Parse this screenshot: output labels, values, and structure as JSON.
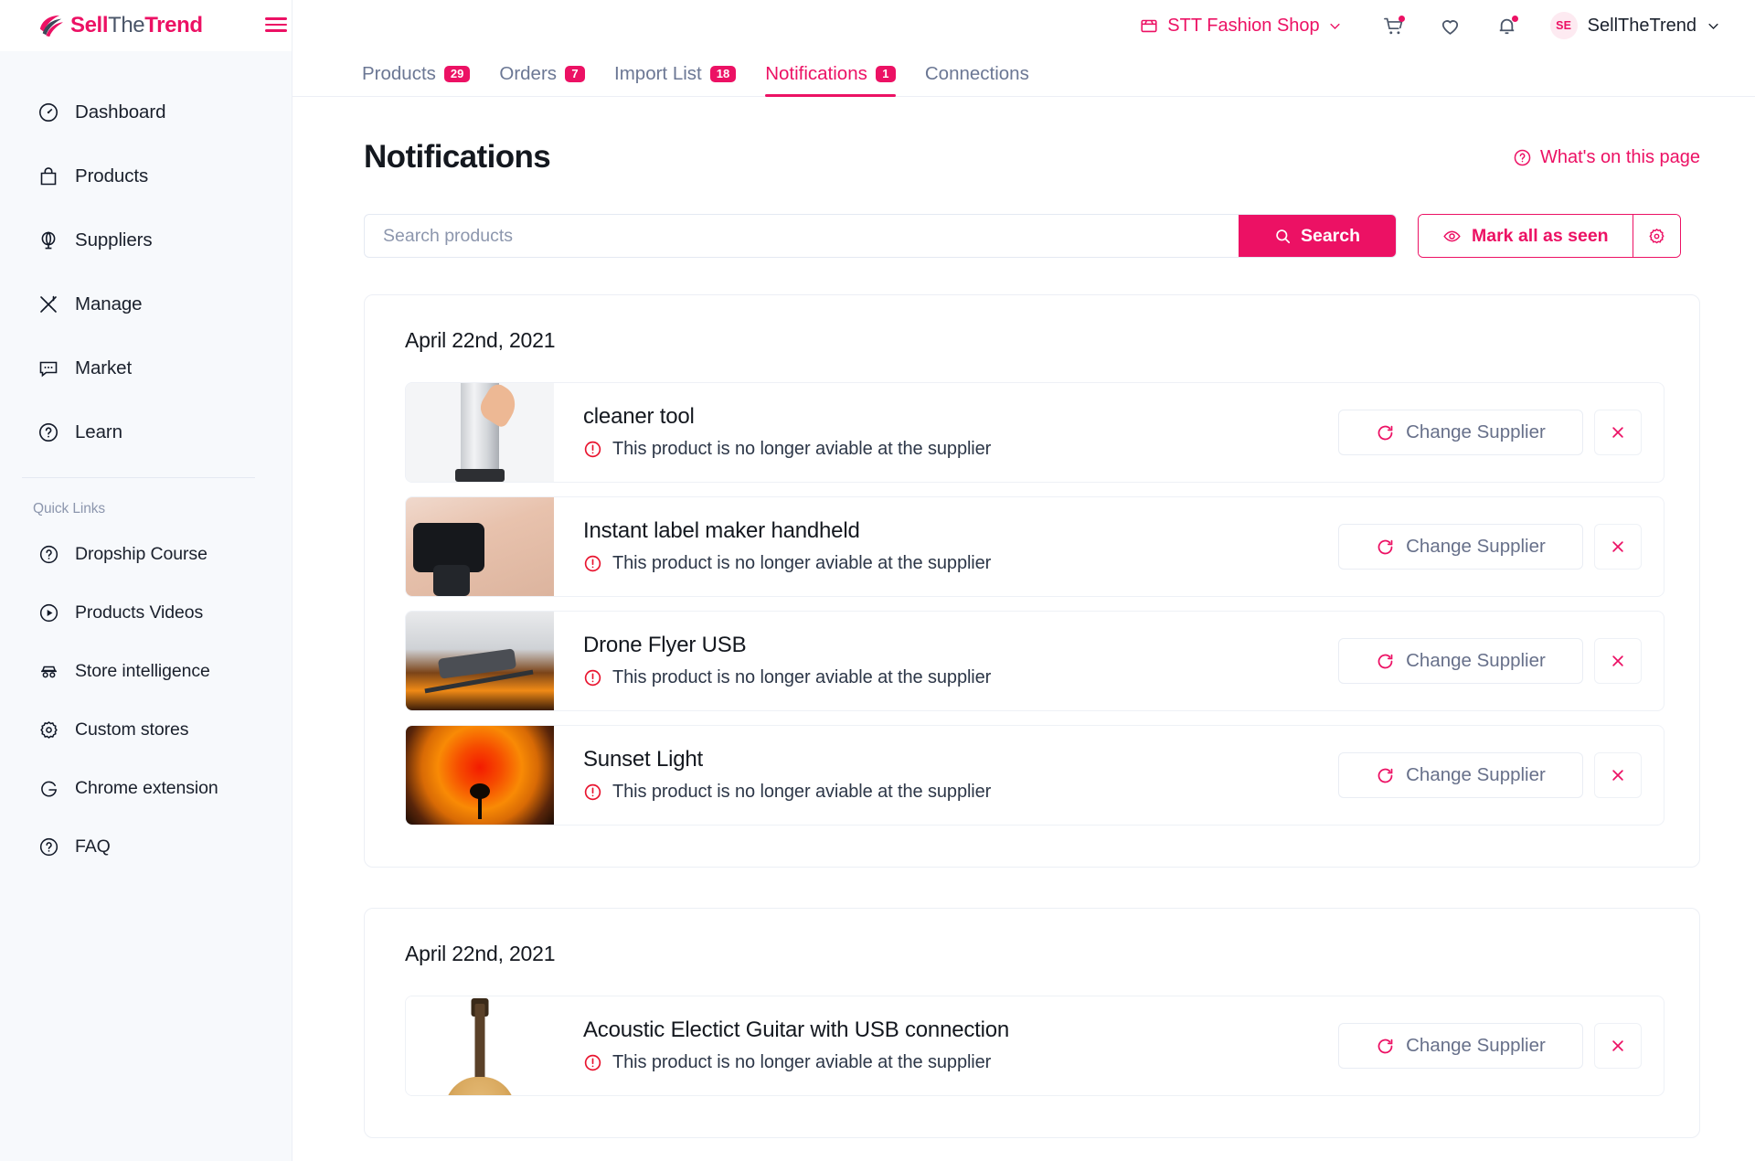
{
  "brand": {
    "logo_sell": "Sell",
    "logo_the": "The",
    "logo_trend": "Trend",
    "accent_color": "#ec1164",
    "menu_icon": "hamburger-icon"
  },
  "sidebar": {
    "items": [
      {
        "label": "Dashboard",
        "icon": "speedometer-icon"
      },
      {
        "label": "Products",
        "icon": "bag-icon"
      },
      {
        "label": "Suppliers",
        "icon": "globe-icon"
      },
      {
        "label": "Manage",
        "icon": "tools-icon"
      },
      {
        "label": "Market",
        "icon": "chat-icon"
      },
      {
        "label": "Learn",
        "icon": "question-circle-icon"
      }
    ],
    "quick_links_title": "Quick Links",
    "quick_links": [
      {
        "label": "Dropship Course",
        "icon": "question-circle-icon"
      },
      {
        "label": "Products Videos",
        "icon": "play-circle-icon"
      },
      {
        "label": "Store intelligence",
        "icon": "spy-icon"
      },
      {
        "label": "Custom stores",
        "icon": "gear-icon"
      },
      {
        "label": "Chrome extension",
        "icon": "google-g-icon"
      },
      {
        "label": "FAQ",
        "icon": "question-circle-icon"
      }
    ]
  },
  "topbar": {
    "shop_name": "STT Fashion Shop",
    "shop_icon": "store-icon",
    "shop_chevron": "chevron-down-icon",
    "cart_icon": "cart-icon",
    "wishlist_icon": "heart-icon",
    "bell_icon": "bell-icon",
    "avatar_initials": "SE",
    "user_name": "SellTheTrend",
    "user_chevron": "chevron-down-icon"
  },
  "tabs": [
    {
      "label": "Products",
      "badge": "29",
      "active": false
    },
    {
      "label": "Orders",
      "badge": "7",
      "active": false
    },
    {
      "label": "Import List",
      "badge": "18",
      "active": false
    },
    {
      "label": "Notifications",
      "badge": "1",
      "active": true
    },
    {
      "label": "Connections",
      "badge": "",
      "active": false
    }
  ],
  "page": {
    "title": "Notifications",
    "help_link": "What's on this page",
    "help_icon": "question-circle-icon"
  },
  "search": {
    "placeholder": "Search products",
    "value": "",
    "button_label": "Search",
    "button_icon": "search-icon"
  },
  "mark_all": {
    "label": "Mark all as seen",
    "icon": "eye-icon",
    "settings_icon": "gear-icon"
  },
  "actions": {
    "change_supplier_label": "Change Supplier",
    "change_supplier_icon": "refresh-icon",
    "close_icon": "close-icon"
  },
  "groups": [
    {
      "date": "April 22nd, 2021",
      "items": [
        {
          "title": "cleaner tool",
          "message": "This product is no longer aviable at the supplier",
          "thumb": "cleaner",
          "alert_icon": "alert-circle-icon"
        },
        {
          "title": "Instant label maker handheld",
          "message": "This product is no longer aviable at the supplier",
          "thumb": "label",
          "alert_icon": "alert-circle-icon"
        },
        {
          "title": "Drone Flyer USB",
          "message": "This product is no longer aviable at the supplier",
          "thumb": "drone",
          "alert_icon": "alert-circle-icon"
        },
        {
          "title": "Sunset Light",
          "message": "This product is no longer aviable at the supplier",
          "thumb": "sunset",
          "alert_icon": "alert-circle-icon"
        }
      ]
    },
    {
      "date": "April 22nd, 2021",
      "items": [
        {
          "title": "Acoustic Electict Guitar with USB connection",
          "message": "This product is no longer aviable at the supplier",
          "thumb": "guitar",
          "alert_icon": "alert-circle-icon"
        }
      ]
    }
  ]
}
